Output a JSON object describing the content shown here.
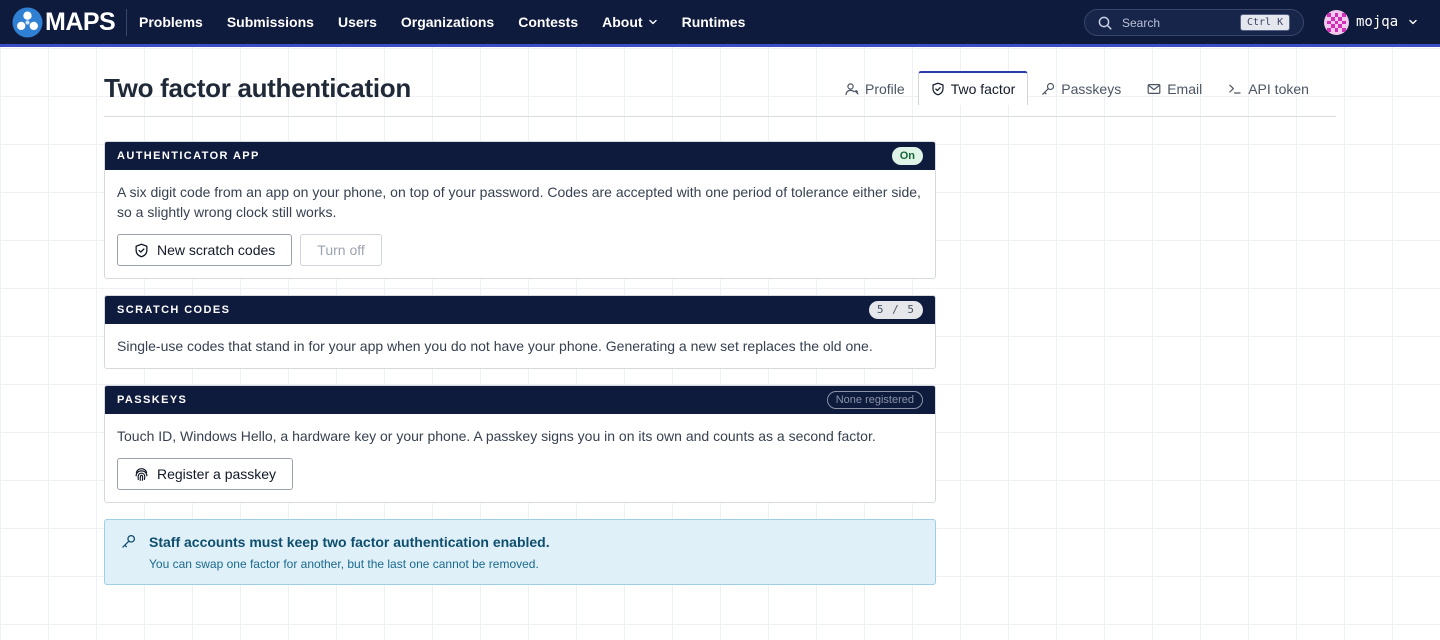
{
  "brand": {
    "logo_text": "MAPS"
  },
  "nav": {
    "items": [
      {
        "label": "Problems"
      },
      {
        "label": "Submissions"
      },
      {
        "label": "Users"
      },
      {
        "label": "Organizations"
      },
      {
        "label": "Contests"
      },
      {
        "label": "About",
        "icon": "chevron-down-icon"
      },
      {
        "label": "Runtimes"
      }
    ]
  },
  "search": {
    "placeholder": "Search",
    "shortcut": "Ctrl K",
    "icon": "search-icon"
  },
  "user": {
    "name": "mojqa",
    "icon": "chevron-down-icon"
  },
  "header": {
    "title": "Two factor authentication",
    "tabs": [
      {
        "label": "Profile",
        "icon": "user-icon"
      },
      {
        "label": "Two factor",
        "icon": "shield-check-icon",
        "active": true
      },
      {
        "label": "Passkeys",
        "icon": "key-icon"
      },
      {
        "label": "Email",
        "icon": "mail-icon"
      },
      {
        "label": "API token",
        "icon": "terminal-icon"
      }
    ]
  },
  "authenticator": {
    "title": "AUTHENTICATOR APP",
    "status": "On",
    "description": "A six digit code from an app on your phone, on top of your password. Codes are accepted with one period of tolerance either side, so a slightly wrong clock still works.",
    "new_codes_label": "New scratch codes",
    "turn_off_label": "Turn off"
  },
  "scratch": {
    "title": "SCRATCH CODES",
    "count": "5 / 5",
    "description": "Single-use codes that stand in for your app when you do not have your phone. Generating a new set replaces the old one."
  },
  "passkeys": {
    "title": "PASSKEYS",
    "status": "None registered",
    "description": "Touch ID, Windows Hello, a hardware key or your phone. A passkey signs you in on its own and counts as a second factor.",
    "register_label": "Register a passkey"
  },
  "notice": {
    "title": "Staff accounts must keep two factor authentication enabled.",
    "subtitle": "You can swap one factor for another, but the last one cannot be removed."
  },
  "colors": {
    "navbar": "#0f1b3d",
    "accent": "#3b4fc4",
    "success": "#17663a",
    "info_bg": "#dff0f8"
  }
}
